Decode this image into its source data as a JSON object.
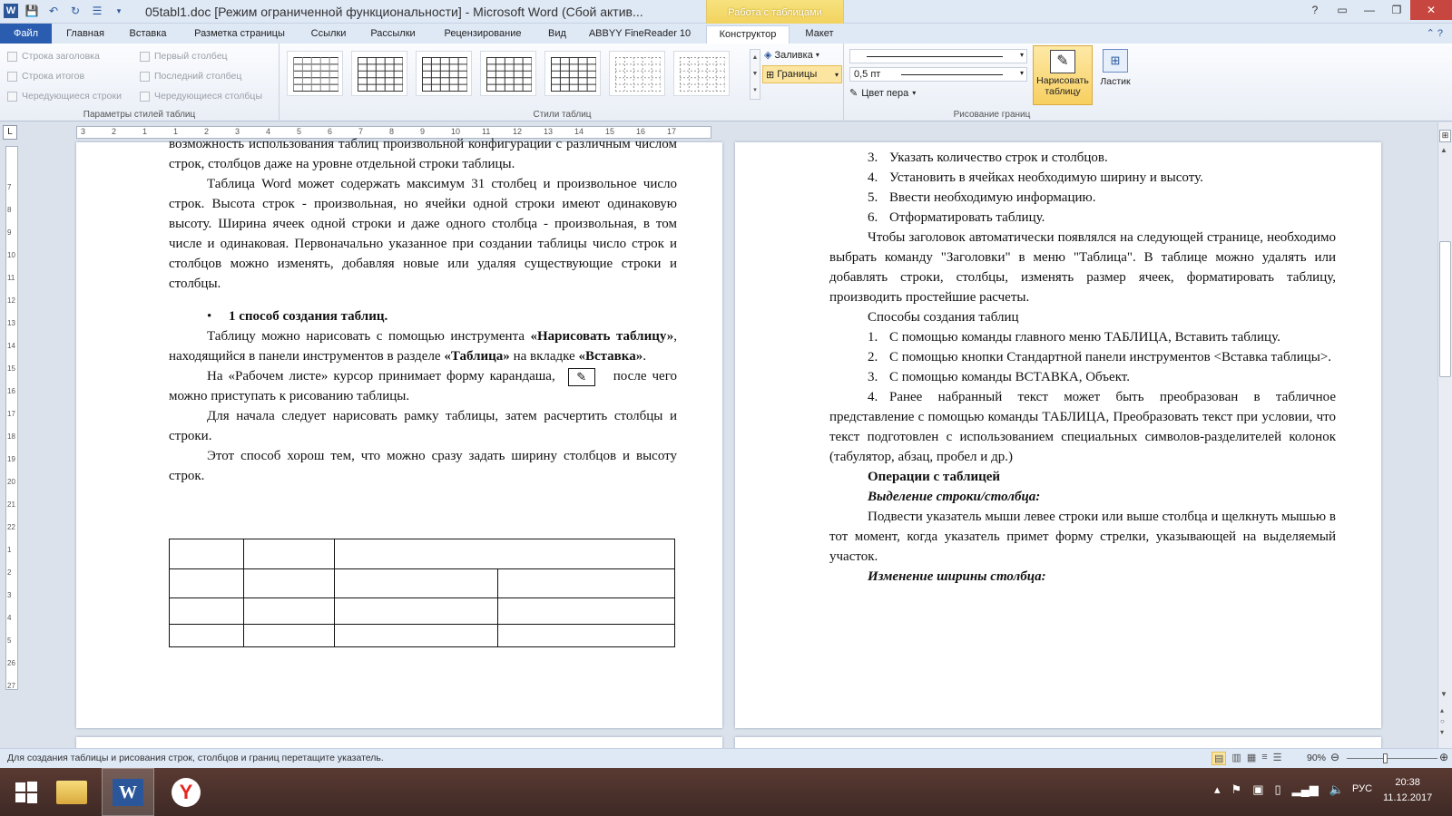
{
  "window": {
    "title": "05tabl1.doc [Режим ограниченной функциональности]  -  Microsoft Word (Сбой актив...",
    "context_group": "Работа с таблицами"
  },
  "tabs": [
    "Файл",
    "Главная",
    "Вставка",
    "Разметка страницы",
    "Ссылки",
    "Рассылки",
    "Рецензирование",
    "Вид",
    "ABBYY FineReader 10",
    "Конструктор",
    "Макет"
  ],
  "ribbon": {
    "style_options": {
      "label": "Параметры стилей таблиц",
      "items": [
        "Строка заголовка",
        "Первый столбец",
        "Строка итогов",
        "Последний столбец",
        "Чередующиеся строки",
        "Чередующиеся столбцы"
      ]
    },
    "table_styles": {
      "label": "Стили таблиц"
    },
    "shading_label": "Заливка",
    "borders_label": "Границы",
    "draw_borders": {
      "label": "Рисование границ",
      "weight": "0,5 пт",
      "pen_color": "Цвет пера",
      "draw_table": "Нарисовать таблицу",
      "eraser": "Ластик"
    }
  },
  "page_left": {
    "paragraphs": [
      "возможность использования таблиц произвольной конфигурации с различным числом строк, столбцов даже на уровне отдельной строки таблицы.",
      "Таблица Word может содержать максимум 31 столбец и произвольное число строк. Высота строк - произвольная, но ячейки одной строки имеют одинаковую высоту. Ширина ячеек одной строки и даже одного столбца - произвольная, в том числе и одинаковая. Первоначально указанное при создании таблицы число строк и столбцов можно изменять, добавляя новые или удаляя существующие строки и столбцы.",
      "1 способ создания таблиц.",
      "Таблицу можно нарисовать с помощью инструмента ",
      "«Нарисовать таблицу»",
      ", находящийся в панели инструментов в разделе ",
      "«Таблица»",
      " на вкладке ",
      "«Вставка»",
      ".",
      "На «Рабочем листе» курсор принимает форму карандаша,",
      "после чего можно приступать  к рисованию таблицы.",
      "Для начала следует нарисовать рамку таблицы, затем расчертить столбцы и строки.",
      "Этот способ хорош тем, что можно сразу задать ширину столбцов и высоту строк."
    ]
  },
  "page_right": {
    "list_a": [
      {
        "n": "3.",
        "t": "Указать количество строк и столбцов."
      },
      {
        "n": "4.",
        "t": "Установить в ячейках необходимую ширину и высоту."
      },
      {
        "n": "5.",
        "t": "Ввести необходимую информацию."
      },
      {
        "n": "6.",
        "t": "Отформатировать таблицу."
      }
    ],
    "para1": "Чтобы заголовок автоматически появлялся на следующей странице, необходимо выбрать команду \"Заголовки\" в меню \"Таблица\". В таблице можно удалять или добавлять строки, столбцы, изменять размер ячеек, форматировать таблицу, производить простейшие расчеты.",
    "methods_title": "Способы создания таблиц",
    "list_b": [
      {
        "n": "1.",
        "t": "С помощью команды главного меню ТАБЛИЦА, Вставить таблицу."
      },
      {
        "n": "2.",
        "t": "С помощью кнопки Стандартной панели инструментов <Вставка таблицы>."
      },
      {
        "n": "3.",
        "t": "С помощью команды ВСТАВКА, Объект."
      },
      {
        "n": "4.",
        "t": "Ранее набранный текст может быть преобразован в табличное представление с помощью команды ТАБЛИЦА, Преобразовать текст при условии, что текст подготовлен с использованием специальных символов-разделителей колонок (табулятор, абзац, пробел и др.)"
      }
    ],
    "ops_title": "Операции с таблицей",
    "sel_title": "Выделение строки/столбца:",
    "sel_text": "Подвести указатель мыши левее строки или выше столбца и щелкнуть мышью в тот момент, когда указатель примет форму стрелки, указывающей на выделяемый участок.",
    "width_title": "Изменение ширины столбца:"
  },
  "ruler_numbers": [
    "3",
    "2",
    "1",
    "1",
    "2",
    "3",
    "4",
    "5",
    "6",
    "7",
    "8",
    "9",
    "10",
    "11",
    "12",
    "13",
    "14",
    "15",
    "16",
    "17"
  ],
  "vruler_numbers": [
    "7",
    "8",
    "9",
    "10",
    "11",
    "12",
    "13",
    "14",
    "15",
    "16",
    "17",
    "18",
    "19",
    "20",
    "21",
    "22",
    "1",
    "2",
    "3",
    "4",
    "5",
    "26",
    "27"
  ],
  "status": {
    "hint": "Для создания таблицы и рисования строк, столбцов и границ перетащите указатель.",
    "zoom": "90%"
  },
  "taskbar": {
    "lang": "РУС",
    "time": "20:38",
    "date": "11.12.2017"
  }
}
